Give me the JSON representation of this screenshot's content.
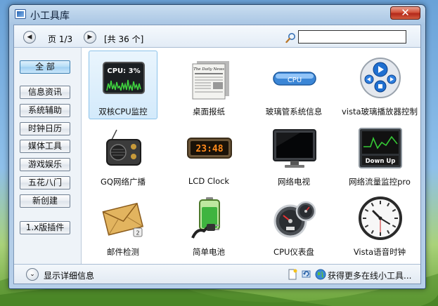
{
  "window": {
    "title": "小工具库",
    "close_label": "✕"
  },
  "toolbar": {
    "prev_label": "◀",
    "next_label": "▶",
    "page_label": "页 1/3",
    "count_label": "[共 36 个]",
    "search_value": "",
    "search_placeholder": ""
  },
  "sidebar": {
    "items": [
      {
        "label": "全  部",
        "active": true
      },
      {
        "label": "信息资讯"
      },
      {
        "label": "系统辅助"
      },
      {
        "label": "时钟日历"
      },
      {
        "label": "媒体工具"
      },
      {
        "label": "游戏娱乐"
      },
      {
        "label": "五花八门"
      },
      {
        "label": "新创建"
      },
      {
        "label": "1.x版插件"
      }
    ]
  },
  "gadgets": [
    {
      "label": "双核CPU监控",
      "icon": "cpu-meter-icon",
      "screen_text": "CPU: 3%"
    },
    {
      "label": "桌面报纸",
      "icon": "newspaper-icon",
      "screen_text": "The Daily News"
    },
    {
      "label": "玻璃管系统信息",
      "icon": "cpu-glass-tube-icon",
      "screen_text": "CPU"
    },
    {
      "label": "vista玻璃播放器控制",
      "icon": "media-player-control-icon"
    },
    {
      "label": "GQ网络广播",
      "icon": "radio-icon"
    },
    {
      "label": "LCD Clock",
      "icon": "lcd-clock-icon",
      "screen_text": "23:48"
    },
    {
      "label": "网络电视",
      "icon": "tv-monitor-icon"
    },
    {
      "label": "网络流量监控pro",
      "icon": "network-traffic-icon",
      "screen_text": "Down Up"
    },
    {
      "label": "邮件检测",
      "icon": "mail-envelope-icon",
      "screen_text": "2"
    },
    {
      "label": "简单电池",
      "icon": "battery-plug-icon"
    },
    {
      "label": "CPU仪表盘",
      "icon": "cpu-gauge-icon"
    },
    {
      "label": "Vista语音时钟",
      "icon": "analog-clock-icon"
    }
  ],
  "footer": {
    "expand_label": "⌄",
    "details_label": "显示详细信息",
    "more_label": "获得更多在线小工具..."
  },
  "colors": {
    "accent": "#3c7fb1",
    "close_button": "#c8432b",
    "selection": "#d3eafb",
    "lcd_digits": "#ff8a1c"
  }
}
